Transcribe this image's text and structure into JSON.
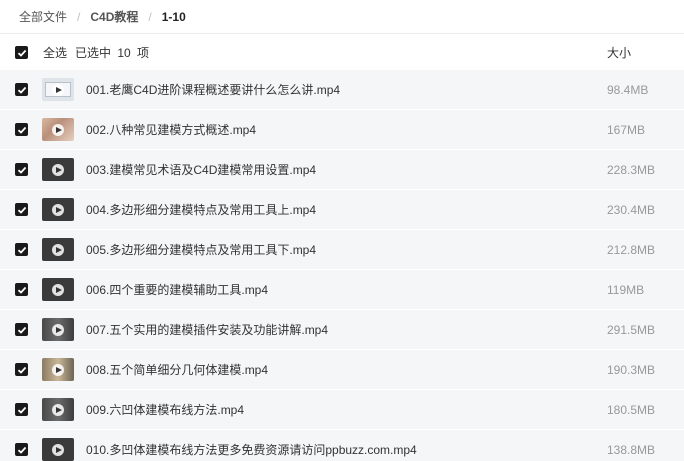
{
  "breadcrumb": {
    "root": "全部文件",
    "folder": "C4D教程",
    "current": "1-10",
    "separator": "/"
  },
  "header": {
    "select_all": "全选",
    "selected_count": "已选中 10 项",
    "size_column": "大小"
  },
  "files": [
    {
      "name": "001.老鹰C4D进阶课程概述要讲什么怎么讲.mp4",
      "size": "98.4MB",
      "thumb": "light"
    },
    {
      "name": "002.八种常见建模方式概述.mp4",
      "size": "167MB",
      "thumb": "photo"
    },
    {
      "name": "003.建模常见术语及C4D建模常用设置.mp4",
      "size": "228.3MB",
      "thumb": "dark"
    },
    {
      "name": "004.多边形细分建模特点及常用工具上.mp4",
      "size": "230.4MB",
      "thumb": "dark"
    },
    {
      "name": "005.多边形细分建模特点及常用工具下.mp4",
      "size": "212.8MB",
      "thumb": "dark"
    },
    {
      "name": "006.四个重要的建模辅助工具.mp4",
      "size": "119MB",
      "thumb": "dark"
    },
    {
      "name": "007.五个实用的建模插件安装及功能讲解.mp4",
      "size": "291.5MB",
      "thumb": "gray"
    },
    {
      "name": "008.五个简单细分几何体建模.mp4",
      "size": "190.3MB",
      "thumb": "sand"
    },
    {
      "name": "009.六凹体建模布线方法.mp4",
      "size": "180.5MB",
      "thumb": "gray"
    },
    {
      "name": "010.多凹体建模布线方法更多免费资源请访问ppbuzz.com.mp4",
      "size": "138.8MB",
      "thumb": "dark"
    }
  ],
  "icons": {
    "checkbox": "checkbox-checked-icon",
    "video": "video-thumbnail-icon"
  },
  "colors": {
    "checkbox": "#1a1a1a",
    "row_background": "#f5f6f8",
    "size_text": "#999999"
  }
}
